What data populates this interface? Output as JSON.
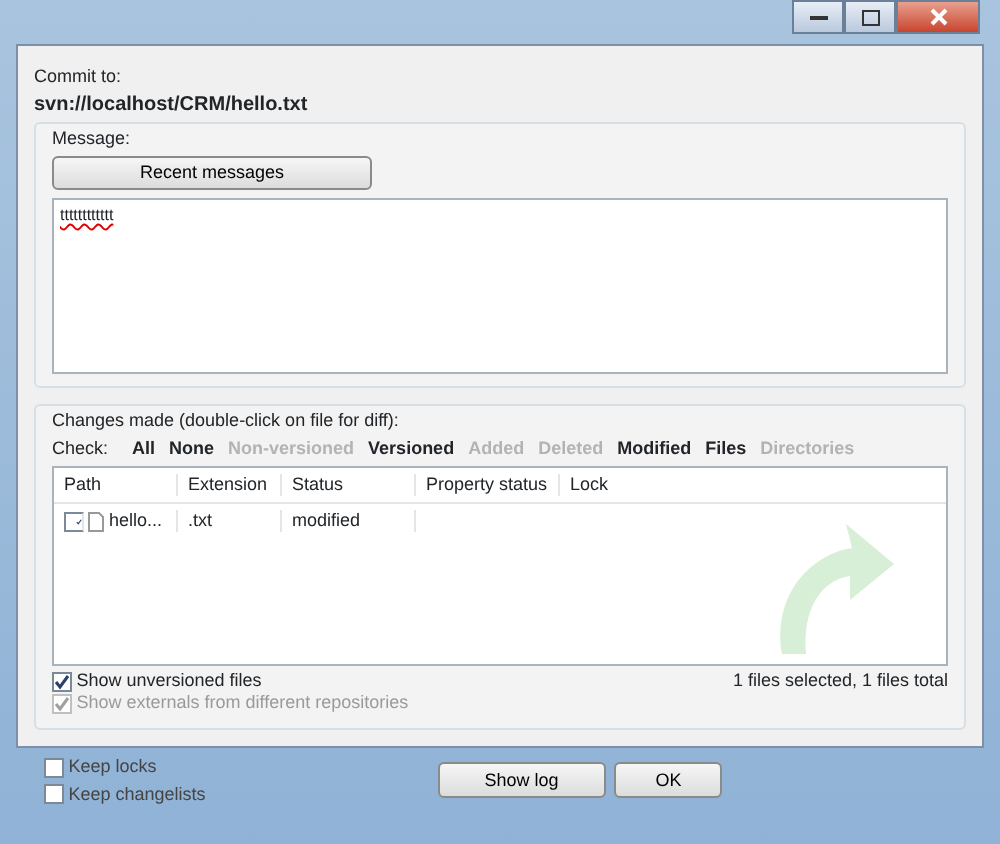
{
  "commit_to": {
    "label": "Commit to:",
    "url": "svn://localhost/CRM/hello.txt"
  },
  "message": {
    "label": "Message:",
    "recent_button": "Recent messages",
    "text": "tttttttttttt"
  },
  "changes": {
    "label": "Changes made (double-click on file for diff):",
    "check_label": "Check:",
    "filters": [
      {
        "label": "All",
        "enabled": true
      },
      {
        "label": "None",
        "enabled": true
      },
      {
        "label": "Non-versioned",
        "enabled": false
      },
      {
        "label": "Versioned",
        "enabled": true
      },
      {
        "label": "Added",
        "enabled": false
      },
      {
        "label": "Deleted",
        "enabled": false
      },
      {
        "label": "Modified",
        "enabled": true
      },
      {
        "label": "Files",
        "enabled": true
      },
      {
        "label": "Directories",
        "enabled": false
      }
    ],
    "table": {
      "columns": [
        "Path",
        "Extension",
        "Status",
        "Property status",
        "Lock"
      ],
      "rows": [
        {
          "checked": true,
          "path": "hello...",
          "extension": ".txt",
          "status": "modified"
        }
      ]
    },
    "options": [
      {
        "label": "Show unversioned files",
        "checked": true,
        "disabled": false
      },
      {
        "label": "Show externals from different repositories",
        "checked": true,
        "disabled": true
      }
    ],
    "summary": "1 files selected, 1 files total"
  },
  "bottom_options": [
    {
      "label": "Keep locks",
      "checked": false
    },
    {
      "label": "Keep changelists",
      "checked": false
    }
  ],
  "buttons": [
    "Show log",
    "OK"
  ]
}
